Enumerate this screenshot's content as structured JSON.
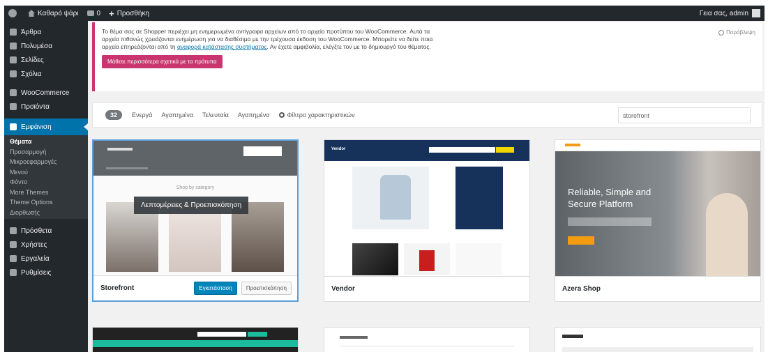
{
  "adminbar": {
    "site_name": "Καθαρό ψάρι",
    "comments_count": "0",
    "new_label": "Προσθήκη",
    "greeting": "Γεια σας, admin"
  },
  "sidebar": {
    "items_top": [
      {
        "label": "Άρθρα",
        "icon": "pin-icon"
      },
      {
        "label": "Πολυμέσα",
        "icon": "media-icon"
      },
      {
        "label": "Σελίδες",
        "icon": "pages-icon"
      },
      {
        "label": "Σχόλια",
        "icon": "comments-icon"
      }
    ],
    "items_mid": [
      {
        "label": "WooCommerce",
        "icon": "woocommerce-icon"
      },
      {
        "label": "Προϊόντα",
        "icon": "products-icon"
      }
    ],
    "current": {
      "label": "Εμφάνιση",
      "icon": "appearance-icon"
    },
    "submenu": [
      "Θέματα",
      "Προσαρμογή",
      "Μικροεφαρμογές",
      "Μενού",
      "Φόντο",
      "More Themes",
      "Theme Options",
      "Διορθωτής"
    ],
    "items_bottom": [
      {
        "label": "Πρόσθετα",
        "icon": "plugins-icon"
      },
      {
        "label": "Χρήστες",
        "icon": "users-icon"
      },
      {
        "label": "Εργαλεία",
        "icon": "tools-icon"
      },
      {
        "label": "Ρυθμίσεις",
        "icon": "settings-icon"
      }
    ]
  },
  "notice": {
    "text_1": "Το θέμα σας σε Shopper περιέχει μη ενημερωμένα αντίγραφα αρχείων από το αρχείο προτύπου του WooCommerce. Αυτά τα αρχεία πιθανώς χρειάζονται ενημέρωση για να διαθέσιμα με την τρέχουσα έκδοση του WooCommerce. Μπορείτε να δείτε ποια αρχεία επηρεάζονται από τη ",
    "link": "αναφορά κατάστασης συστήματος",
    "text_2": ". Αν έχετε αμφιβολία, ελέγξτε τον με το δημιουργό του θέματος.",
    "button": "Μάθετε περισσότερα σχετικά με τα πρότυπα",
    "dismiss": "Παράβλεψη"
  },
  "filterbar": {
    "count": "32",
    "links": [
      "Ενεργά",
      "Αγαπημένα",
      "Τελευταία",
      "Αγαπημένα"
    ],
    "feature_filter": "Φίλτρο χαρακτηριστικών",
    "search_value": "storefront"
  },
  "themes": [
    {
      "name": "Storefront",
      "overlay": "Λεπτομέρειες & Προεπισκόπηση",
      "caption": "Shop by category",
      "install": "Εγκατάσταση",
      "preview": "Προεπισκόπηση"
    },
    {
      "name": "Vendor",
      "logo": "Vendor"
    },
    {
      "name": "Azera Shop",
      "hero_line_1": "Reliable, Simple and",
      "hero_line_2": "Secure Platform"
    }
  ],
  "colors": {
    "admin_dark": "#23282d",
    "accent_blue": "#0073aa",
    "notice_pink": "#c9356e"
  }
}
